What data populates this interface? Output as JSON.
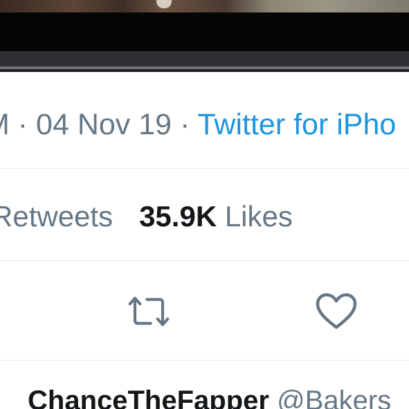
{
  "tweet": {
    "time_fragment": "M",
    "separator1": " · ",
    "date": "04 Nov 19",
    "separator2": " · ",
    "source": "Twitter for iPho"
  },
  "stats": {
    "retweets_label": "Retweets",
    "likes_count": "35.9K",
    "likes_label": "Likes"
  },
  "actions": {
    "retweet_icon": "retweet-icon",
    "like_icon": "heart-icon"
  },
  "reply": {
    "author_name": "ChanceTheFapper",
    "author_handle": "@Bakers"
  },
  "colors": {
    "text_primary": "#14171a",
    "text_secondary": "#657786",
    "link": "#1b95e0",
    "divider": "#e1e8ed"
  }
}
